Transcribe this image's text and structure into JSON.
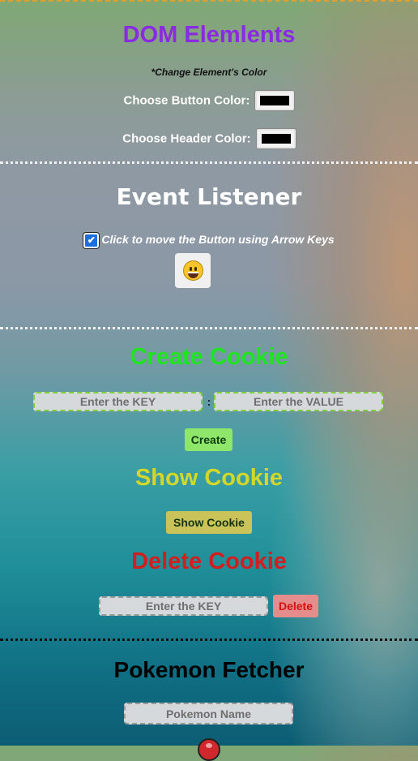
{
  "dom_section": {
    "title": "DOM Elemlents",
    "subtitle": "*Change Element's Color",
    "button_color_label": "Choose Button Color:",
    "header_color_label": "Choose Header Color:",
    "button_color_value": "#000000",
    "header_color_value": "#000000"
  },
  "event_section": {
    "title": "Event Listener",
    "checkbox_label": "Click to move the Button using Arrow Keys",
    "checkbox_checked": true,
    "emoji_button_icon": "grinning-face-icon"
  },
  "create_cookie": {
    "title": "Create Cookie",
    "key_placeholder": "Enter the KEY",
    "separator": ":",
    "value_placeholder": "Enter the VALUE",
    "button_label": "Create"
  },
  "show_cookie": {
    "title": "Show Cookie",
    "button_label": "Show Cookie"
  },
  "delete_cookie": {
    "title": "Delete Cookie",
    "key_placeholder": "Enter the KEY",
    "button_label": "Delete"
  },
  "pokemon": {
    "title": "Pokemon Fetcher",
    "name_placeholder": "Pokemon Name",
    "icon": "pokeball-icon"
  },
  "colors": {
    "dom_title": "#8a2be2",
    "create_title": "#1ee61e",
    "show_title": "#d2d82a",
    "delete_title": "#d21e1e",
    "top_border": "#e0a030"
  }
}
